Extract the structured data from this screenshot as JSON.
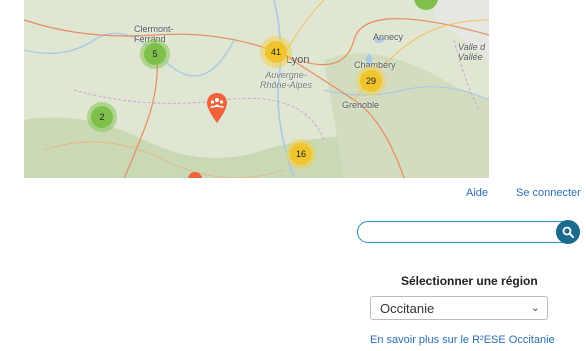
{
  "map": {
    "cities": {
      "clermont": "Clermont-\nFerrand",
      "lyon": "Lyon",
      "annecy": "Annecy",
      "chambery": "Chambéry",
      "grenoble": "Grenoble",
      "valle": "Valle d\nVallée"
    },
    "region_label": "Auvergne-\nRhône-Alpes",
    "clusters": [
      {
        "count": "5",
        "color": "green"
      },
      {
        "count": "41",
        "color": "yellow"
      },
      {
        "count": "29",
        "color": "yellow"
      },
      {
        "count": "2",
        "color": "green"
      },
      {
        "count": "16",
        "color": "yellow"
      }
    ],
    "marker_icon": "group-marker-icon"
  },
  "nav": {
    "help_label": "Aide",
    "login_label": "Se connecter"
  },
  "search": {
    "placeholder": "",
    "icon": "search-icon"
  },
  "region": {
    "title": "Sélectionner une région",
    "selected": "Occitanie",
    "link": "En savoir plus sur le R²ESE Occitanie"
  },
  "colors": {
    "link": "#2b6fb4",
    "search_button": "#1d6a8f",
    "cluster_green": "#7fc04b",
    "cluster_yellow": "#f0c52c",
    "marker": "#f0623a"
  }
}
